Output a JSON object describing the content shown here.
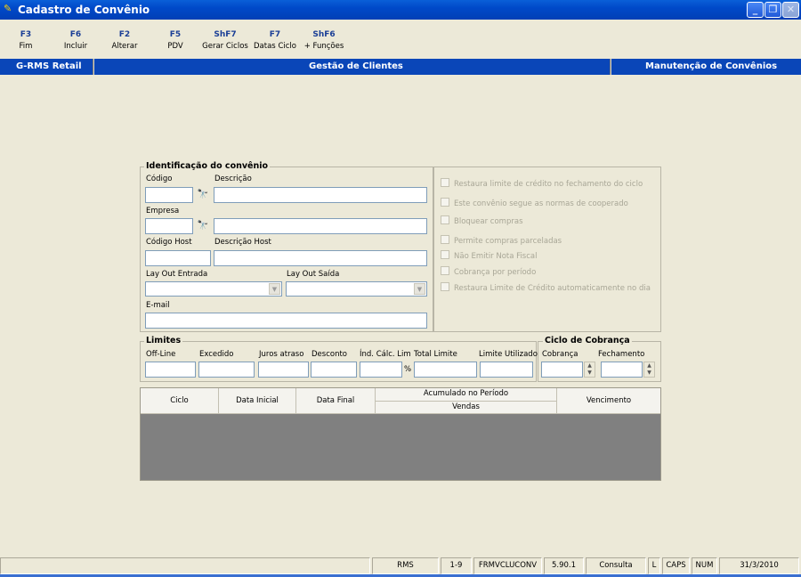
{
  "window": {
    "title": "Cadastro de Convênio",
    "controls": [
      "minimize",
      "restore",
      "close"
    ]
  },
  "function_keys": [
    {
      "key": "F3",
      "label": "Fim"
    },
    {
      "key": "F6",
      "label": "Incluir"
    },
    {
      "key": "F2",
      "label": "Alterar"
    },
    {
      "key": "F5",
      "label": "PDV"
    },
    {
      "key": "ShF7",
      "label": "Gerar Ciclos"
    },
    {
      "key": "F7",
      "label": "Datas Ciclo"
    },
    {
      "key": "ShF6",
      "label": "+ Funções"
    }
  ],
  "header": {
    "app": "G-RMS Retail",
    "module": "Gestão de Clientes",
    "screen": "Manutenção de Convênios"
  },
  "identificacao": {
    "title": "Identificação do convênio",
    "codigo_label": "Código",
    "descricao_label": "Descrição",
    "empresa_label": "Empresa",
    "codigo_host_label": "Código Host",
    "descricao_host_label": "Descrição Host",
    "layout_entrada_label": "Lay Out Entrada",
    "layout_saida_label": "Lay Out Saída",
    "email_label": "E-mail",
    "codigo": "",
    "descricao": "",
    "empresa": "",
    "empresa_desc": "",
    "codigo_host": "",
    "descricao_host": "",
    "layout_entrada": "",
    "layout_saida": "",
    "email": ""
  },
  "options": [
    {
      "label": "Restaura limite de crédito no fechamento do ciclo",
      "checked": false
    },
    {
      "label": "Este convênio segue as normas de cooperado",
      "checked": false
    },
    {
      "label": "Bloquear compras",
      "checked": false
    },
    {
      "label": "Permite compras parceladas",
      "checked": false
    },
    {
      "label": "Não Emitir Nota Fiscal",
      "checked": false
    },
    {
      "label": "Cobrança por período",
      "checked": false
    },
    {
      "label": "Restaura Limite de Crédito automaticamente no dia",
      "checked": false
    }
  ],
  "limites": {
    "title": "Limites",
    "offline_label": "Off-Line",
    "excedido_label": "Excedido",
    "juros_label": "Juros atraso",
    "desconto_label": "Desconto",
    "ind_calc_label": "Índ. Cálc. Lim",
    "total_label": "Total Limite",
    "utilizado_label": "Limite Utilizado",
    "percent": "%"
  },
  "ciclo": {
    "title": "Ciclo de Cobrança",
    "cobranca_label": "Cobrança",
    "fechamento_label": "Fechamento"
  },
  "grid": {
    "columns": [
      "Ciclo",
      "Data Inicial",
      "Data Final"
    ],
    "group_header": "Acumulado no Período",
    "group_sub": "Vendas",
    "last_column": "Vencimento",
    "rows": []
  },
  "status": {
    "system": "RMS",
    "range": "1-9",
    "form": "FRMVCLUCONV",
    "version": "5.90.1",
    "mode": "Consulta",
    "l": "L",
    "caps": "CAPS",
    "num": "NUM",
    "date": "31/3/2010"
  },
  "colors": {
    "title_bar": "#0049c9",
    "header_bar": "#0a46b8",
    "background": "#ece9d8",
    "grid_bg": "#808080"
  }
}
